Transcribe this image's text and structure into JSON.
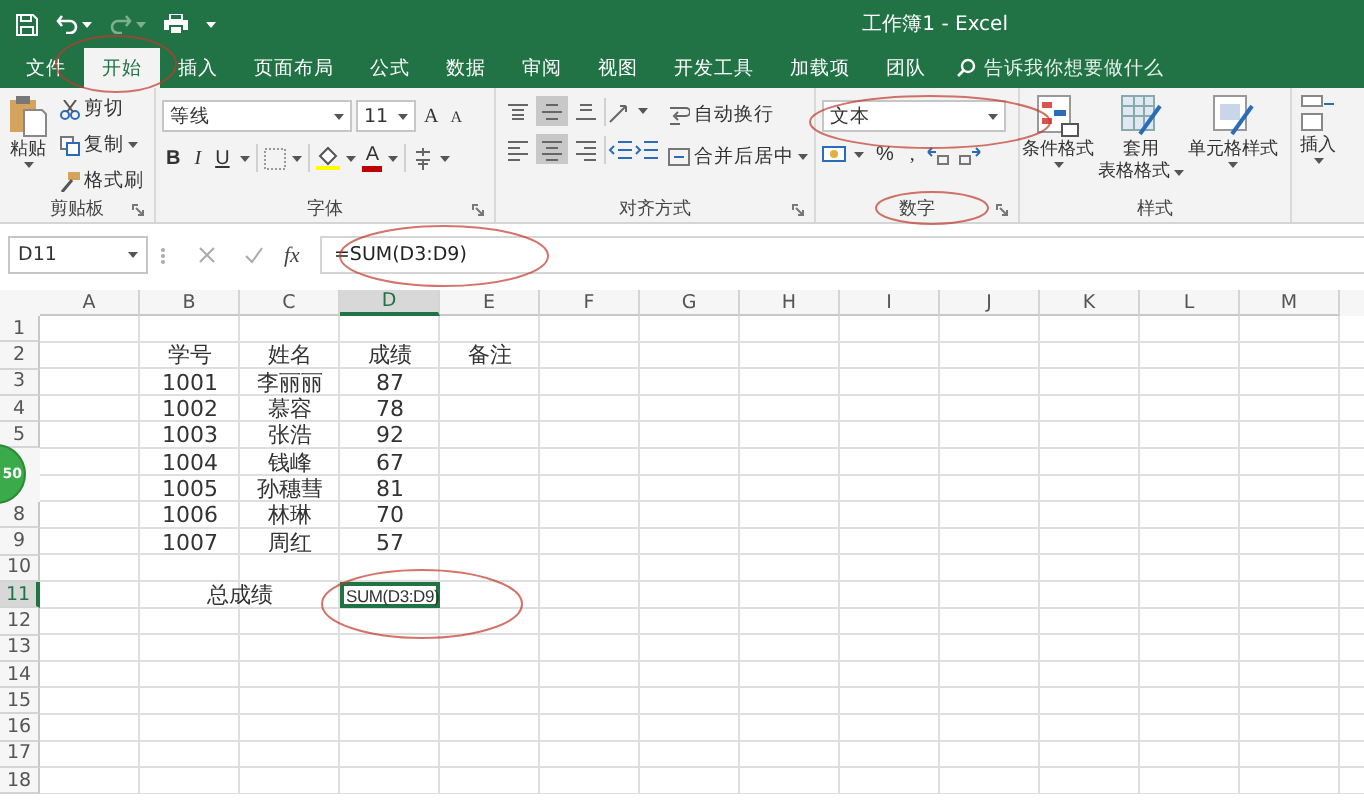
{
  "window": {
    "title": "工作簿1 - Excel"
  },
  "tabs": [
    {
      "label": "文件",
      "selected": false
    },
    {
      "label": "开始",
      "selected": true
    },
    {
      "label": "插入",
      "selected": false
    },
    {
      "label": "页面布局",
      "selected": false
    },
    {
      "label": "公式",
      "selected": false
    },
    {
      "label": "数据",
      "selected": false
    },
    {
      "label": "审阅",
      "selected": false
    },
    {
      "label": "视图",
      "selected": false
    },
    {
      "label": "开发工具",
      "selected": false
    },
    {
      "label": "加载项",
      "selected": false
    },
    {
      "label": "团队",
      "selected": false
    }
  ],
  "tell_me": {
    "placeholder": "告诉我你想要做什么"
  },
  "ribbon": {
    "clipboard": {
      "paste": "粘贴",
      "cut": "剪切",
      "copy": "复制",
      "format_painter": "格式刷",
      "label": "剪贴板"
    },
    "font": {
      "name": "等线",
      "size": "11",
      "grow": "A",
      "shrink": "A",
      "bold": "B",
      "italic": "I",
      "underline": "U",
      "font_color_glyph": "A",
      "label": "字体"
    },
    "alignment": {
      "vertical": [
        {
          "selected": false
        },
        {
          "selected": true
        },
        {
          "selected": false
        }
      ],
      "horizontal": [
        {
          "selected": false
        },
        {
          "selected": true
        },
        {
          "selected": false
        }
      ],
      "wrap": "自动换行",
      "merge": "合并后居中",
      "label": "对齐方式"
    },
    "number": {
      "format": "文本",
      "percent": "%",
      "comma": ",",
      "label": "数字"
    },
    "styles": {
      "conditional": "条件格式",
      "table_1": "套用",
      "table_2": "表格格式",
      "cell_styles": "单元格样式",
      "label": "样式"
    },
    "cells": {
      "insert": "插入"
    }
  },
  "formula_bar": {
    "name_box": "D11",
    "fx": "fx",
    "formula": "=SUM(D3:D9)"
  },
  "sheet": {
    "columns": [
      {
        "label": "A",
        "selected": false
      },
      {
        "label": "B",
        "selected": false
      },
      {
        "label": "C",
        "selected": false
      },
      {
        "label": "D",
        "selected": true
      },
      {
        "label": "E",
        "selected": false
      },
      {
        "label": "F",
        "selected": false
      },
      {
        "label": "G",
        "selected": false
      },
      {
        "label": "H",
        "selected": false
      },
      {
        "label": "I",
        "selected": false
      },
      {
        "label": "J",
        "selected": false
      },
      {
        "label": "K",
        "selected": false
      },
      {
        "label": "L",
        "selected": false
      },
      {
        "label": "M",
        "selected": false
      }
    ],
    "rows": [
      {
        "header": "1",
        "selected": false
      },
      {
        "header": "2",
        "selected": false,
        "cells": [
          null,
          "学号",
          "姓名",
          "成绩",
          "备注"
        ]
      },
      {
        "header": "3",
        "selected": false,
        "cells": [
          null,
          "1001",
          "李丽丽",
          "87"
        ]
      },
      {
        "header": "4",
        "selected": false,
        "cells": [
          null,
          "1002",
          "慕容",
          "78"
        ]
      },
      {
        "header": "5",
        "selected": false,
        "cells": [
          null,
          "1003",
          "张浩",
          "92"
        ]
      },
      {
        "selected": false,
        "cells": [
          null,
          "1004",
          "钱峰",
          "67"
        ]
      },
      {
        "selected": false,
        "cells": [
          null,
          "1005",
          "孙穗彗",
          "81"
        ]
      },
      {
        "header": "8",
        "selected": false,
        "cells": [
          null,
          "1006",
          "林琳",
          "70"
        ]
      },
      {
        "header": "9",
        "selected": false,
        "cells": [
          null,
          "1007",
          "周红",
          "57"
        ]
      },
      {
        "header": "10",
        "selected": false
      },
      {
        "header": "11",
        "selected": true,
        "kind": "total",
        "cells": [
          null,
          "总成绩",
          "SUM(D3:D9)"
        ]
      },
      {
        "header": "12",
        "selected": false
      },
      {
        "header": "13",
        "selected": false
      },
      {
        "header": "14",
        "selected": false
      },
      {
        "header": "15",
        "selected": false
      },
      {
        "header": "16",
        "selected": false
      },
      {
        "header": "17",
        "selected": false
      },
      {
        "header": "18",
        "selected": false
      }
    ]
  },
  "floating_badge": {
    "text": "50"
  }
}
